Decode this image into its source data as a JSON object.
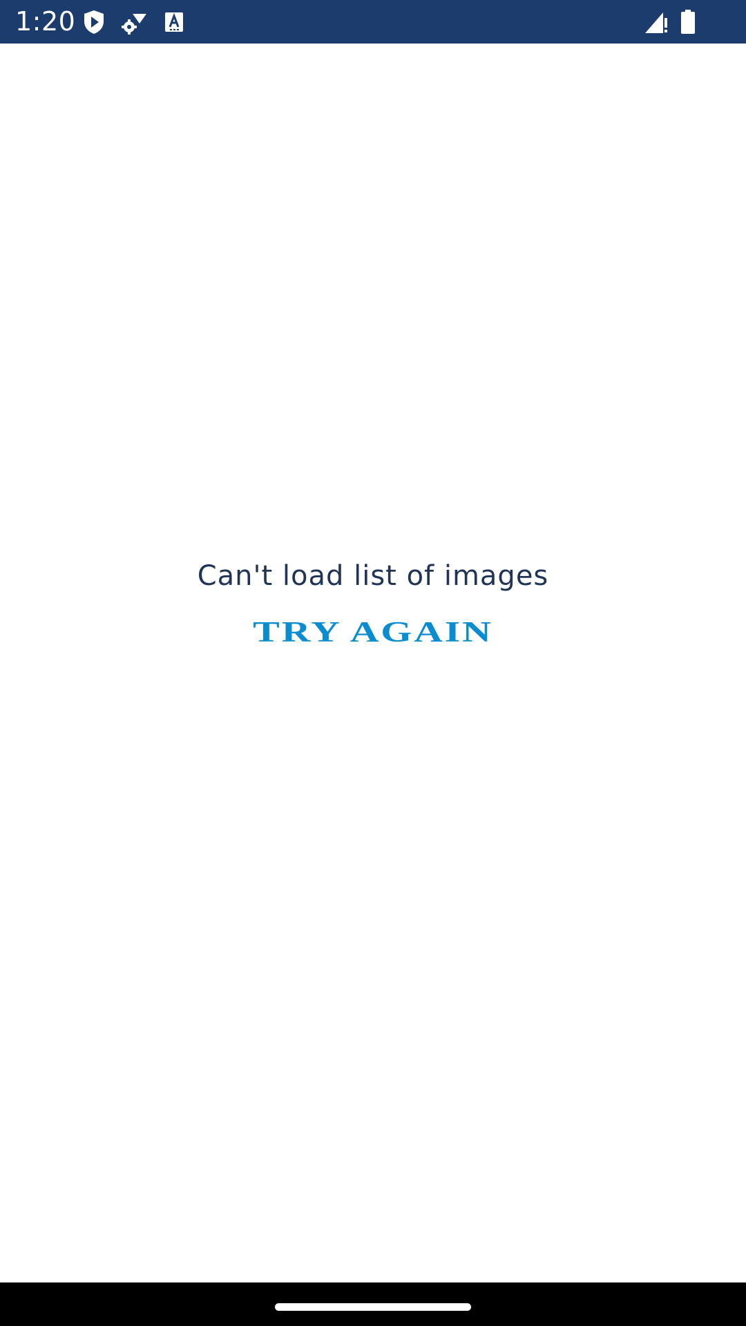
{
  "status_bar": {
    "time": "1:20",
    "background_color": "#1b3c6d",
    "icons": [
      "play-protect-icon",
      "settings-wifi-icon",
      "a-box-icon",
      "signal-icon",
      "battery-icon"
    ]
  },
  "main": {
    "error_message": "Can't load list of images",
    "retry_label": "TRY AGAIN",
    "text_color": "#1f3457",
    "accent_color": "#0a8dd0"
  },
  "nav_bar": {
    "background_color": "#000000"
  }
}
